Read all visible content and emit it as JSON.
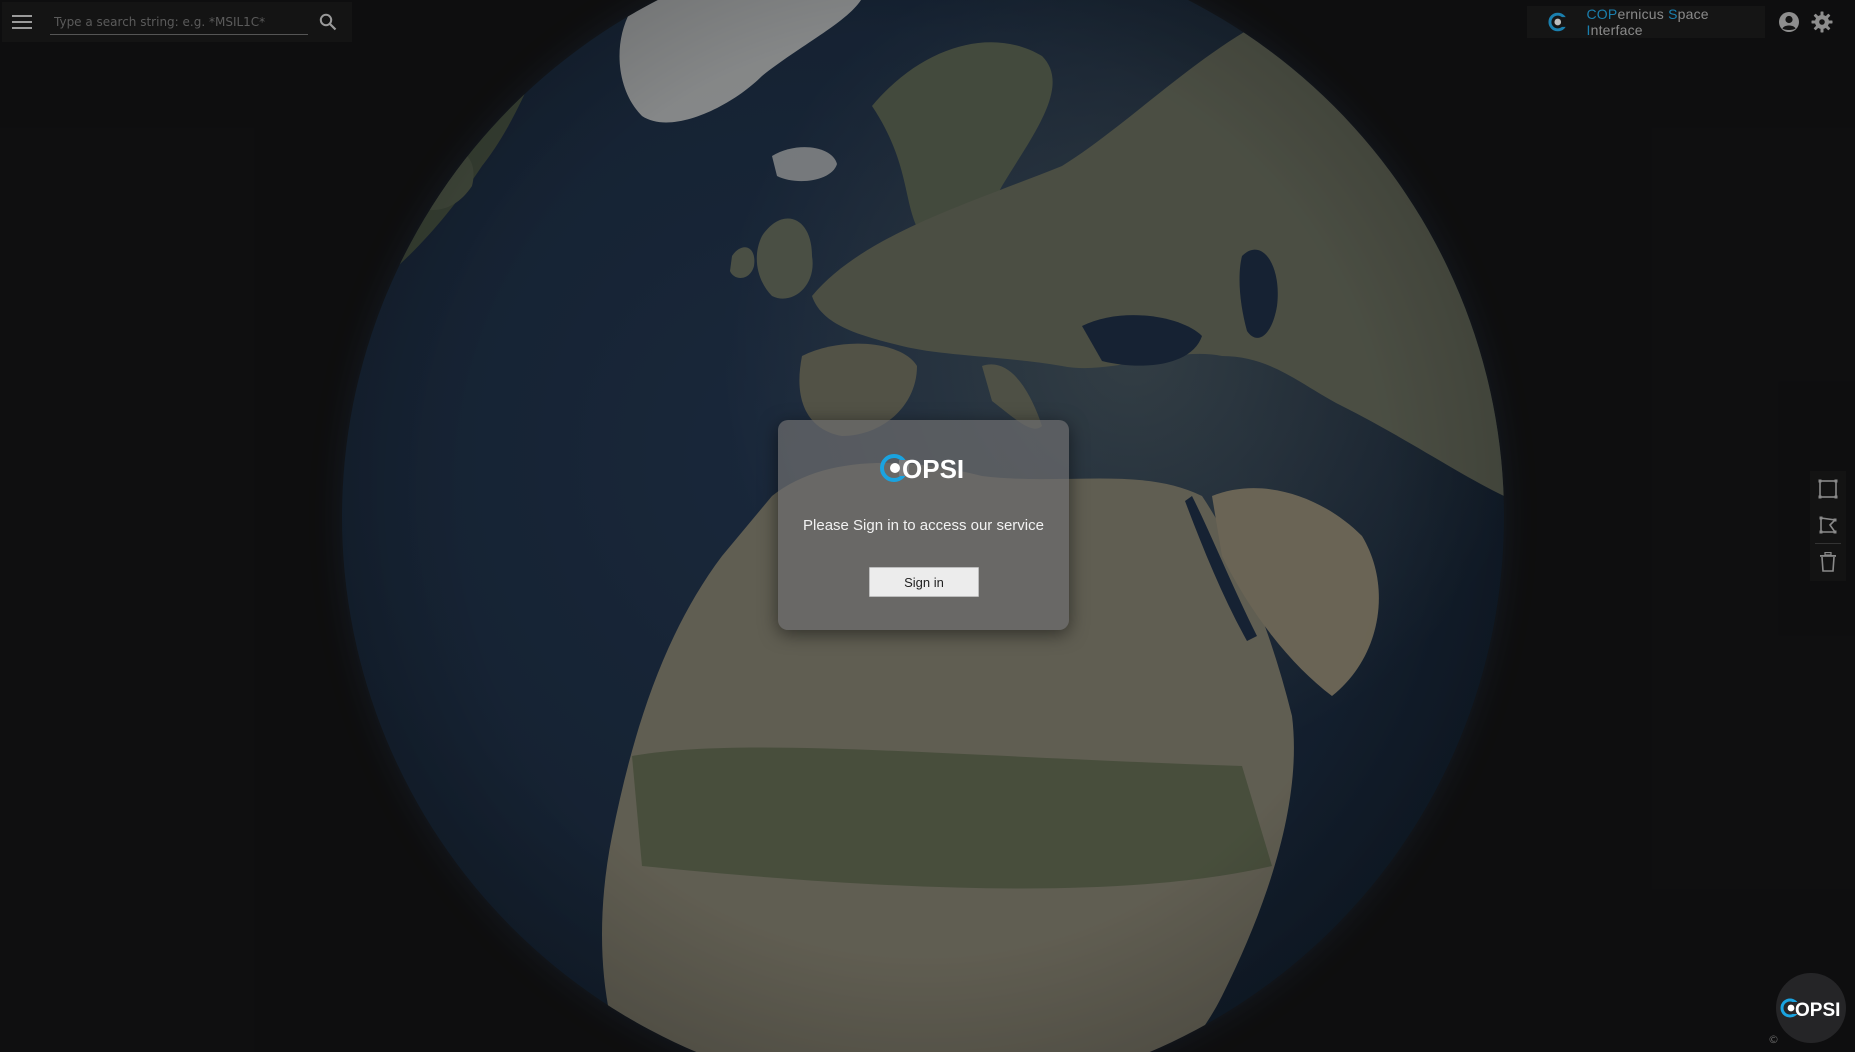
{
  "search": {
    "placeholder": "Type a search string: e.g. *MSIL1C*"
  },
  "brand": {
    "parts": [
      {
        "text": "COP",
        "accent": true
      },
      {
        "text": "ernicus ",
        "accent": false
      },
      {
        "text": "S",
        "accent": true
      },
      {
        "text": "pace ",
        "accent": false
      },
      {
        "text": "I",
        "accent": true
      },
      {
        "text": "nterface",
        "accent": false
      }
    ]
  },
  "dialog": {
    "logo_text": "OPSI",
    "message": "Please Sign in to access our service",
    "signin_label": "Sign in"
  },
  "badge": {
    "logo_text": "OPSI"
  },
  "footer": {
    "copyright_symbol": "©"
  },
  "colors": {
    "accent": "#1aa3e0",
    "background": "#0f0f10",
    "ocean": "#1a2d46",
    "land": "#6b6f5e"
  },
  "icons": {
    "menu": "hamburger-menu-icon",
    "search": "search-icon",
    "user": "user-account-icon",
    "settings": "gear-icon",
    "rectangle": "draw-rectangle-icon",
    "polygon": "draw-polygon-icon",
    "delete": "trash-icon"
  }
}
